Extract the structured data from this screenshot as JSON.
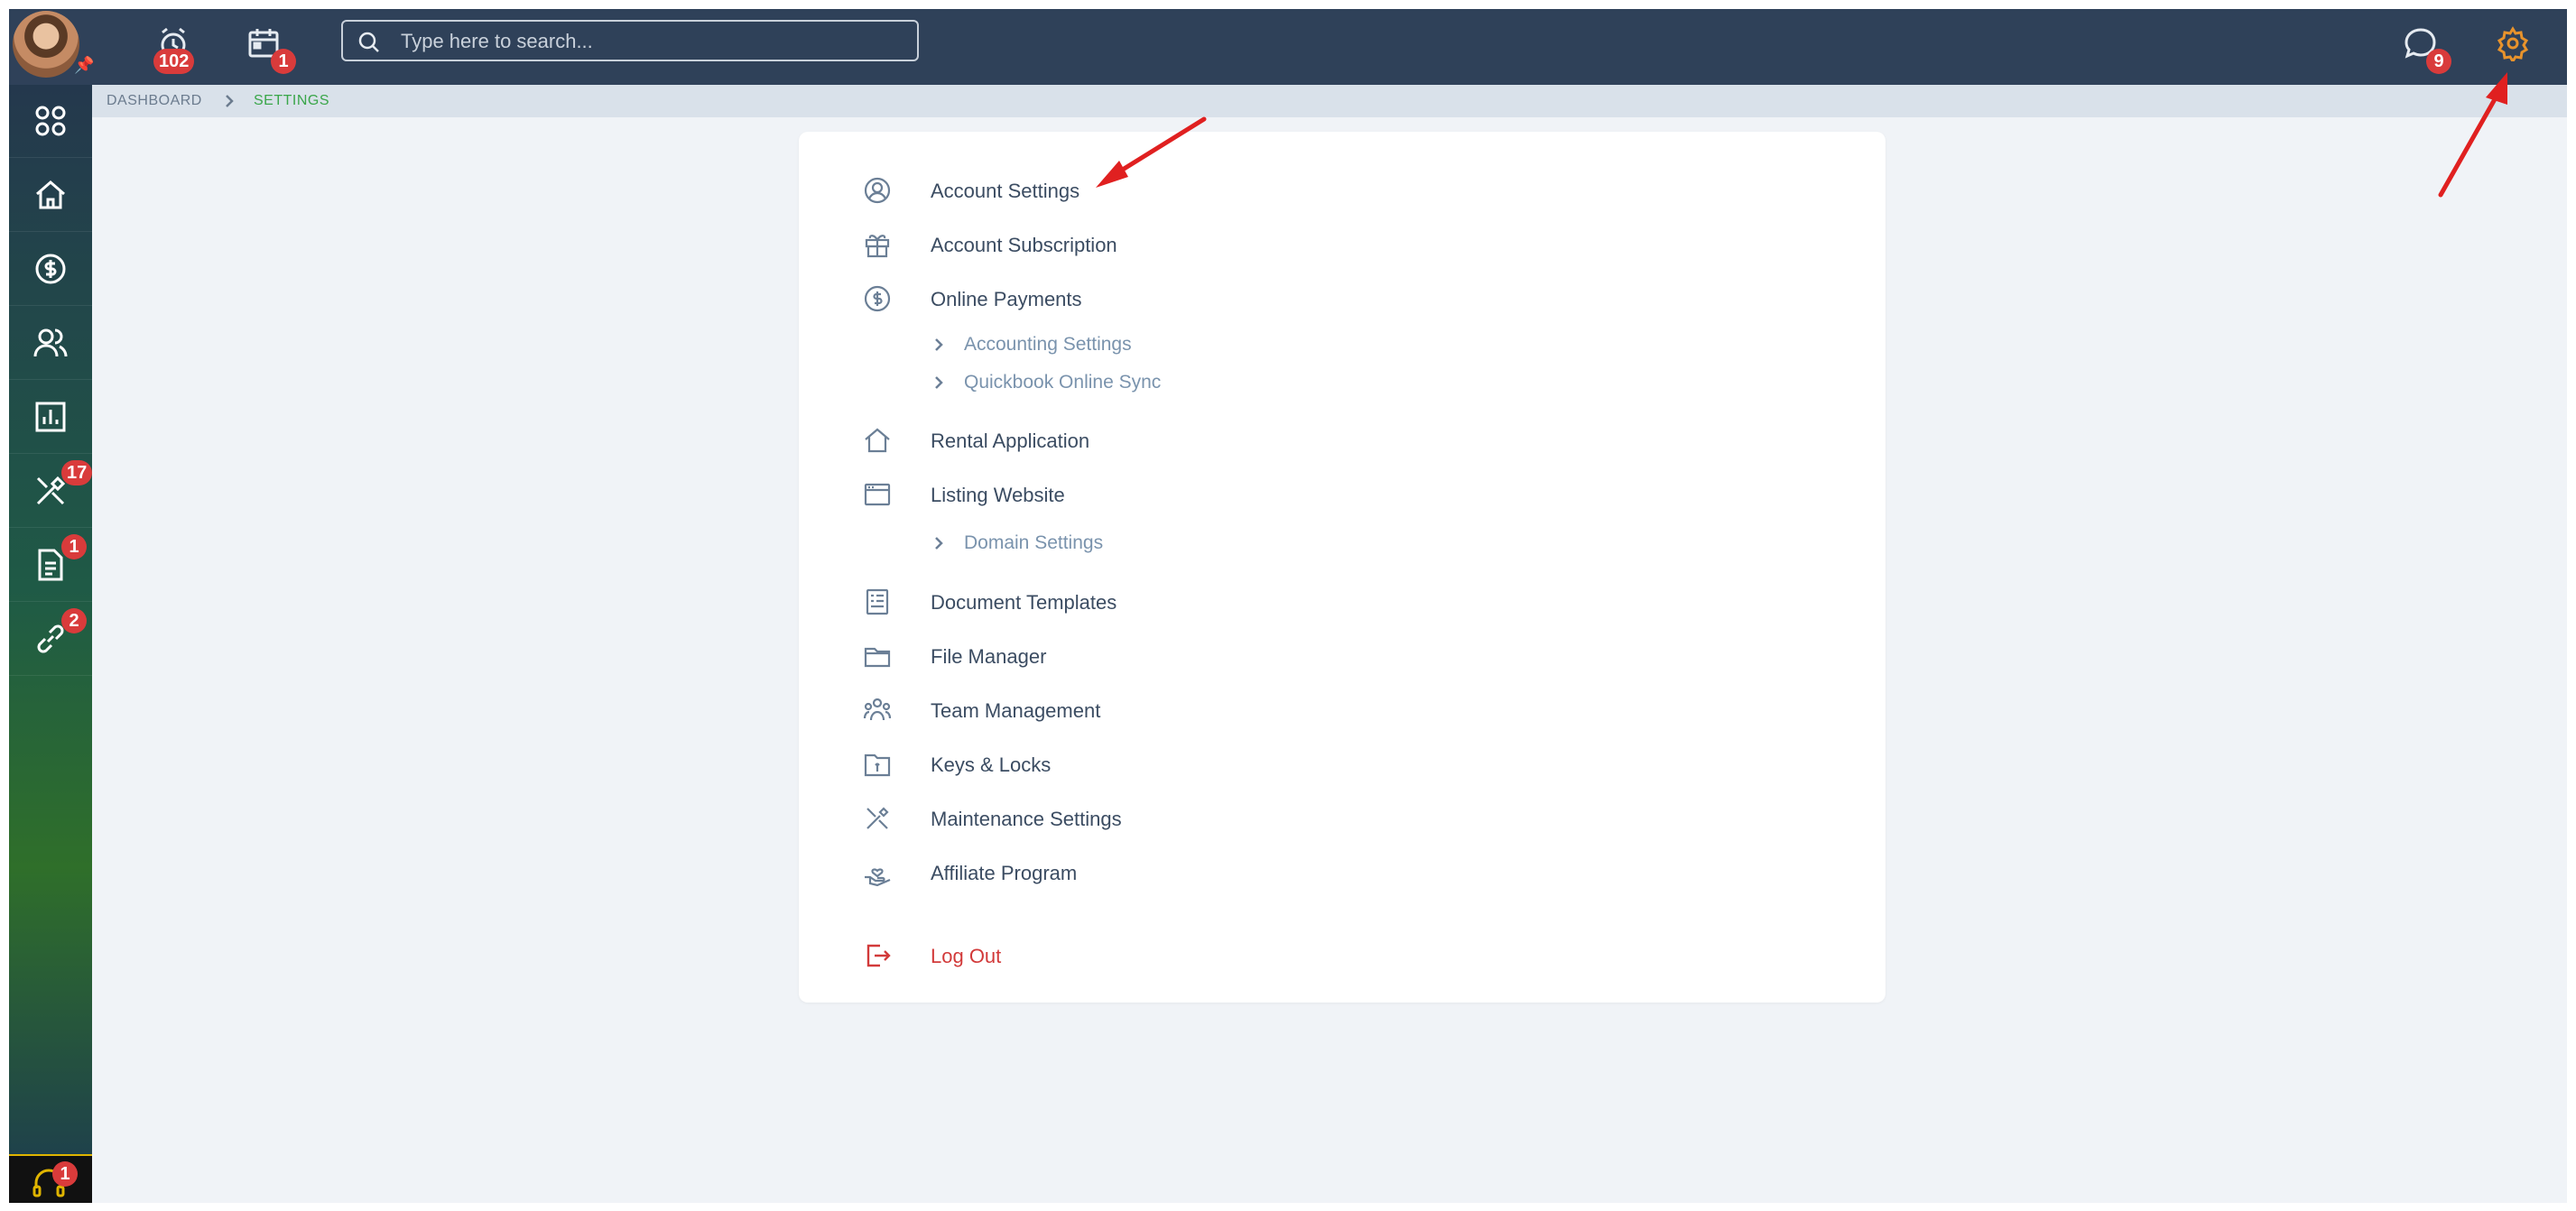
{
  "topbar": {
    "reminders_badge": "102",
    "calendar_badge": "1",
    "search_placeholder": "Type here to search...",
    "messages_badge": "9"
  },
  "sidebar": {
    "items": [
      {
        "name": "apps-icon",
        "badge": ""
      },
      {
        "name": "home-icon",
        "badge": ""
      },
      {
        "name": "dollar-icon",
        "badge": ""
      },
      {
        "name": "people-icon",
        "badge": ""
      },
      {
        "name": "chart-icon",
        "badge": ""
      },
      {
        "name": "tools-icon",
        "badge": "17"
      },
      {
        "name": "document-icon",
        "badge": "1"
      },
      {
        "name": "link-icon",
        "badge": "2"
      }
    ],
    "support_badge": "1"
  },
  "breadcrumb": {
    "dashboard": "DASHBOARD",
    "current": "SETTINGS"
  },
  "settings_menu": {
    "account_settings": "Account Settings",
    "account_subscription": "Account Subscription",
    "online_payments": "Online Payments",
    "accounting_settings": "Accounting Settings",
    "quickbook_sync": "Quickbook Online Sync",
    "rental_application": "Rental Application",
    "listing_website": "Listing Website",
    "domain_settings": "Domain Settings",
    "document_templates": "Document Templates",
    "file_manager": "File Manager",
    "team_management": "Team Management",
    "keys_locks": "Keys & Locks",
    "maintenance_settings": "Maintenance Settings",
    "affiliate_program": "Affiliate Program",
    "log_out": "Log Out"
  },
  "colors": {
    "topbar": "#2f4159",
    "accent_orange": "#e8932c",
    "badge_red": "#d93b3b",
    "breadcrumb_active": "#3aa64a",
    "logout_red": "#d23a3a"
  }
}
